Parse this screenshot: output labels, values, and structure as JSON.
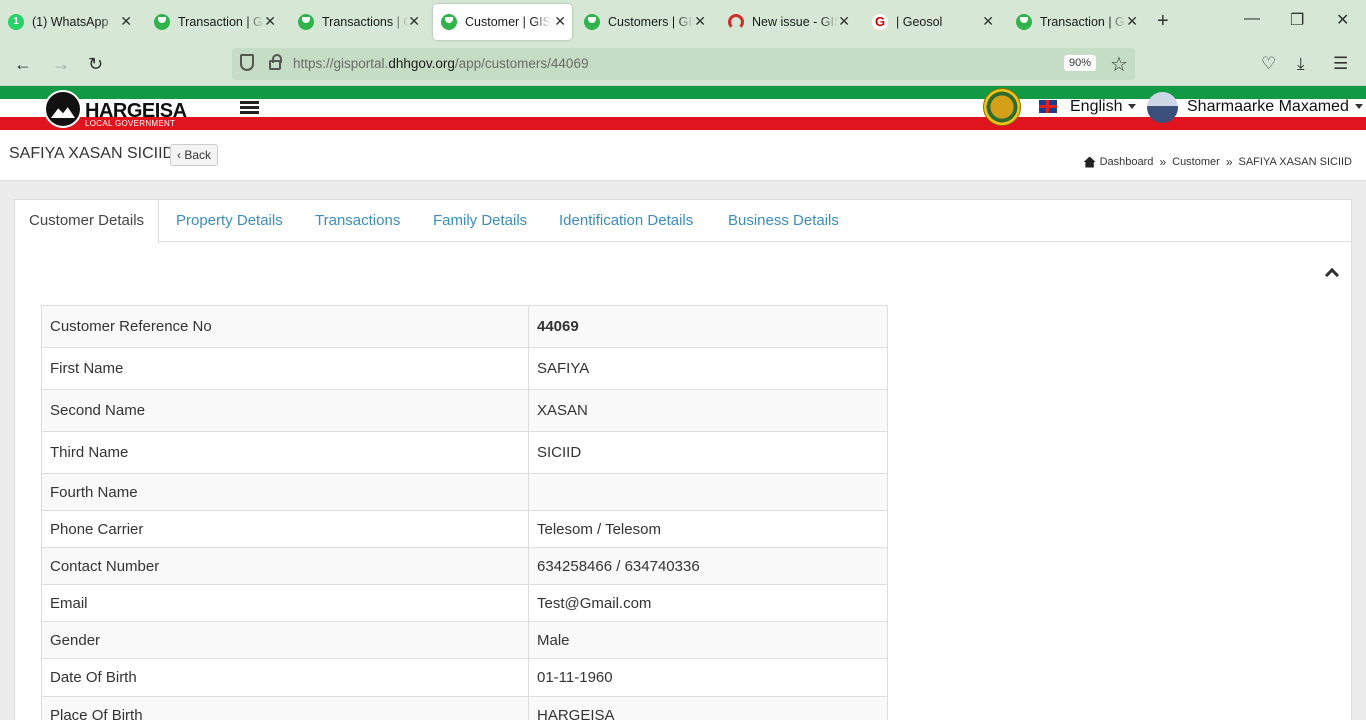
{
  "browser": {
    "tabs": [
      {
        "title": "(1) WhatsApp",
        "icon": "whatsapp-icon",
        "active": false
      },
      {
        "title": "Transaction | GIS Portal",
        "icon": "gis-logo-icon",
        "active": false
      },
      {
        "title": "Transactions | GIS Portal",
        "icon": "gis-logo-icon",
        "active": false
      },
      {
        "title": "Customer | GIS Portal",
        "icon": "gis-logo-icon",
        "active": true
      },
      {
        "title": "Customers | GIS Portal",
        "icon": "gis-logo-icon",
        "active": false
      },
      {
        "title": "New issue - GIS-Portal",
        "icon": "gitlab-icon",
        "active": false
      },
      {
        "title": "| Geosol",
        "icon": "geosol-icon",
        "active": false
      },
      {
        "title": "Transaction | GIS Portal",
        "icon": "gis-logo-icon",
        "active": false
      }
    ],
    "url_prefix": "https://gisportal.",
    "url_host": "dhhgov.org",
    "url_path": "/app/customers/44069",
    "zoom": "90%"
  },
  "header": {
    "logo_title": "HARGEISA",
    "logo_subtitle": "LOCAL GOVERNMENT",
    "language": "English",
    "user_name": "Sharmaarke Maxamed"
  },
  "page": {
    "title": "SAFIYA XASAN SICIID",
    "back_label": "Back",
    "breadcrumb": [
      "Dashboard",
      "Customer",
      "SAFIYA XASAN SICIID"
    ]
  },
  "tabs": [
    {
      "label": "Customer Details",
      "active": true
    },
    {
      "label": "Property Details",
      "active": false
    },
    {
      "label": "Transactions",
      "active": false
    },
    {
      "label": "Family Details",
      "active": false
    },
    {
      "label": "Identification Details",
      "active": false
    },
    {
      "label": "Business Details",
      "active": false
    }
  ],
  "details": [
    {
      "label": "Customer Reference No",
      "value": "44069"
    },
    {
      "label": "First Name",
      "value": "SAFIYA"
    },
    {
      "label": "Second Name",
      "value": "XASAN"
    },
    {
      "label": "Third Name",
      "value": "SICIID"
    },
    {
      "label": "Fourth Name",
      "value": ""
    },
    {
      "label": "Phone Carrier",
      "value": "Telesom / Telesom"
    },
    {
      "label": "Contact Number",
      "value": "634258466 / 634740336"
    },
    {
      "label": "Email",
      "value": "Test@Gmail.com"
    },
    {
      "label": "Gender",
      "value": "Male"
    },
    {
      "label": "Date Of Birth",
      "value": "01-11-1960"
    },
    {
      "label": "Place Of Birth",
      "value": "HARGEISA"
    }
  ],
  "colors": {
    "link": "#3c8dbc",
    "flag_green": "#119944",
    "flag_red": "#e0141e",
    "browser_chrome": "#d6e7d6"
  }
}
